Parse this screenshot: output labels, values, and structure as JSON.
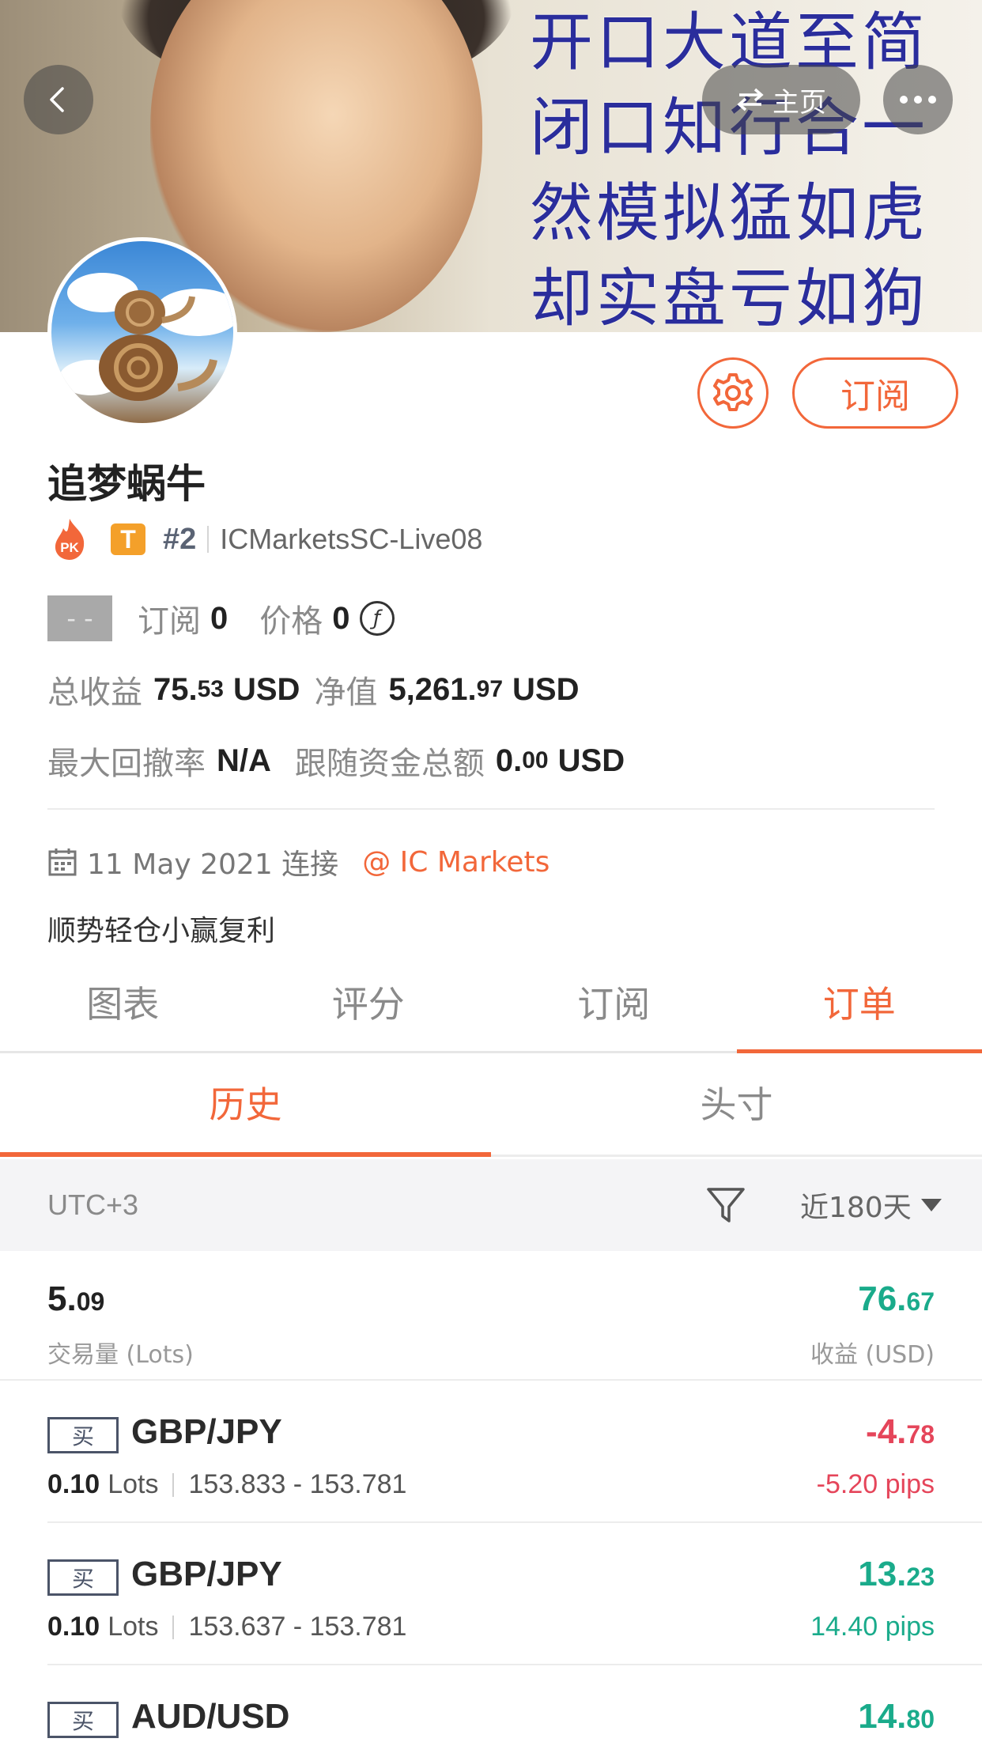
{
  "banner": {
    "text_lines": [
      "开口大道至简",
      "闭口知行合一",
      "然模拟猛如虎",
      "却实盘亏如狗"
    ],
    "home_label": "主页"
  },
  "actions": {
    "subscribe_label": "订阅"
  },
  "profile": {
    "name": "追梦蜗牛",
    "pk_label": "PK",
    "tier_label": "T",
    "rank": "#2",
    "server": "ICMarketsSC-Live08",
    "dash": "- -",
    "subscribers_label": "订阅",
    "subscribers_value": "0",
    "price_label": "价格",
    "price_value": "0",
    "total_profit_label": "总收益",
    "total_profit_int": "75.",
    "total_profit_dec": "53",
    "total_profit_unit": "USD",
    "equity_label": "净值",
    "equity_int": "5,261.",
    "equity_dec": "97",
    "equity_unit": "USD",
    "max_drawdown_label": "最大回撤率",
    "max_drawdown_value": "N/A",
    "follow_funds_label": "跟随资金总额",
    "follow_funds_int": "0.",
    "follow_funds_dec": "00",
    "follow_funds_unit": "USD",
    "connected_text": "11 May 2021 连接",
    "broker": "@ IC Markets",
    "bio": "顺势轻仓小赢复利"
  },
  "main_tabs": [
    "图表",
    "评分",
    "订阅",
    "订单"
  ],
  "main_tab_active": 3,
  "sub_tabs": [
    "历史",
    "头寸"
  ],
  "sub_tab_active": 0,
  "filter": {
    "timezone": "UTC+3",
    "range": "近180天"
  },
  "summary": {
    "lots_int": "5.",
    "lots_dec": "09",
    "lots_label": "交易量 (Lots)",
    "profit_int": "76.",
    "profit_dec": "67",
    "profit_label": "收益 (USD)"
  },
  "orders": [
    {
      "side": "买",
      "symbol": "GBP/JPY",
      "lots": "0.10",
      "lots_unit": "Lots",
      "prices": "153.833 - 153.781",
      "pnl_int": "-4.",
      "pnl_dec": "78",
      "pips": "-5.20 pips",
      "status": "neg"
    },
    {
      "side": "买",
      "symbol": "GBP/JPY",
      "lots": "0.10",
      "lots_unit": "Lots",
      "prices": "153.637 - 153.781",
      "pnl_int": "13.",
      "pnl_dec": "23",
      "pips": "14.40 pips",
      "status": "pos"
    },
    {
      "side": "买",
      "symbol": "AUD/USD",
      "pnl_int": "14.",
      "pnl_dec": "80",
      "status": "pos"
    }
  ],
  "colors": {
    "accent": "#f2673a",
    "positive": "#1aab8b",
    "negative": "#e5455a"
  },
  "icons": [
    "back-icon",
    "swap-icon",
    "more-icon",
    "gear-icon",
    "coin-icon",
    "calendar-icon",
    "filter-icon",
    "caret-down-icon"
  ]
}
